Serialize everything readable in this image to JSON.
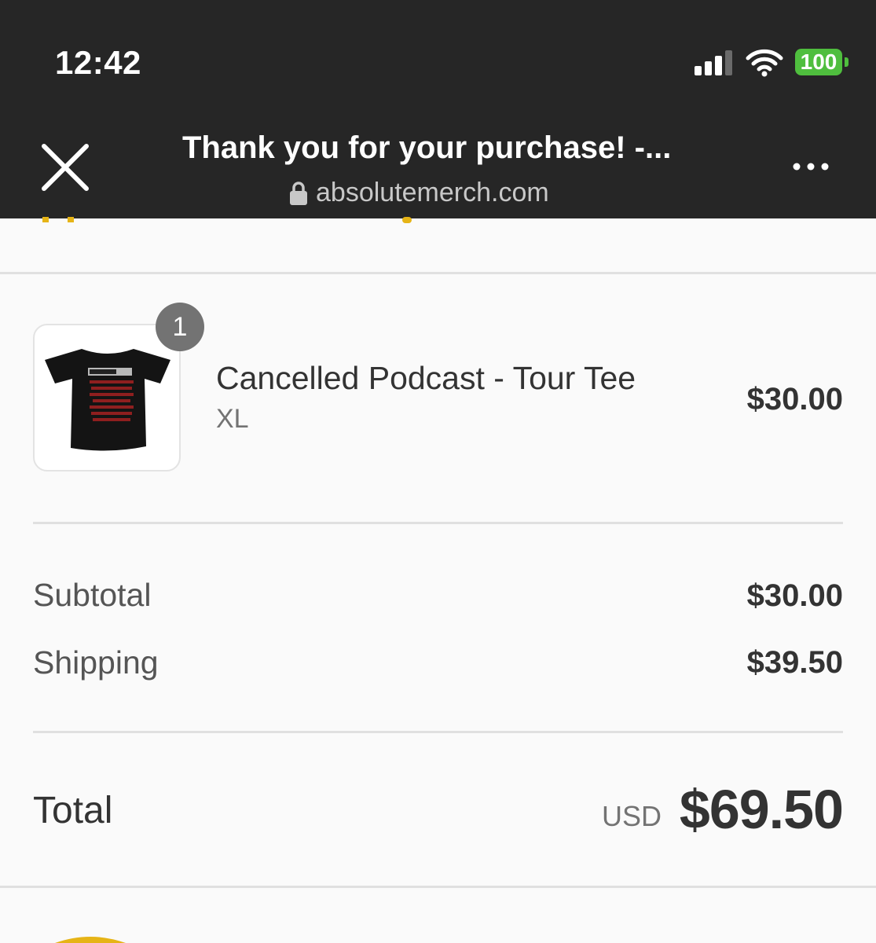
{
  "status_bar": {
    "time": "12:42",
    "battery_level": "100",
    "battery_color": "#4fbe3e"
  },
  "browser": {
    "title": "Thank you for your purchase! -...",
    "url": "absolutemerch.com",
    "close_icon": "close-icon",
    "menu_icon": "more-icon"
  },
  "order": {
    "items": [
      {
        "name": "Cancelled Podcast - Tour Tee",
        "variant": "XL",
        "price": "$30.00",
        "quantity": "1",
        "image": "black-tshirt-image"
      }
    ],
    "subtotal_label": "Subtotal",
    "subtotal": "$30.00",
    "shipping_label": "Shipping",
    "shipping": "$39.50",
    "total_label": "Total",
    "currency": "USD",
    "total": "$69.50"
  },
  "colors": {
    "accent": "#e6b416",
    "header_bg": "#262626",
    "page_bg": "#fafafa"
  }
}
